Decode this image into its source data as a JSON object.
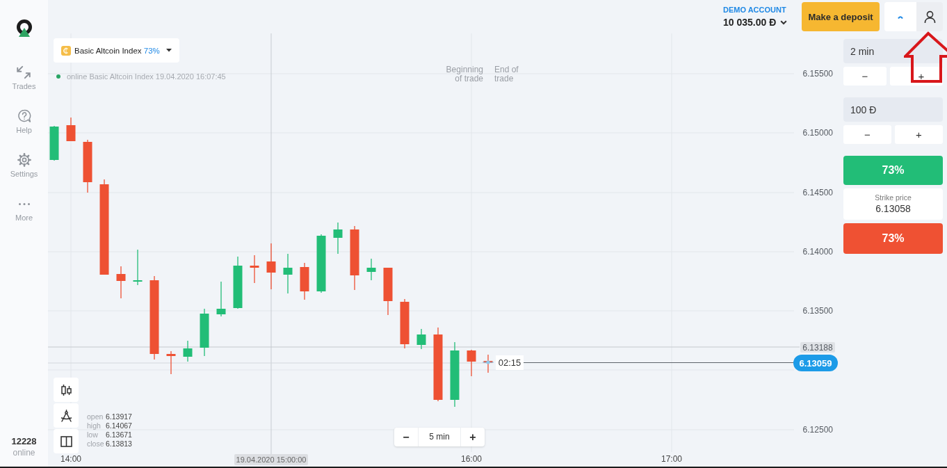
{
  "sidebar": {
    "items": [
      {
        "label": "Trades"
      },
      {
        "label": "Help"
      },
      {
        "label": "Settings"
      },
      {
        "label": "More"
      }
    ],
    "online_count": "12228",
    "online_label": "online"
  },
  "header": {
    "account_type": "DEMO ACCOUNT",
    "balance": "10 035.00 Đ",
    "deposit_button": "Make a deposit"
  },
  "chart": {
    "asset": "Basic Altcoin Index",
    "payout": "73%",
    "status": "online Basic Altcoin Index 19.04.2020 16:07:45",
    "trade_markers": [
      "Beginning of trade",
      "End of trade"
    ],
    "price_ticks": [
      "6.15500",
      "6.15000",
      "6.14500",
      "6.14000",
      "6.13500",
      "6.12500"
    ],
    "level_label": "6.13188",
    "current_price": "6.13059",
    "countdown": "02:15",
    "time_ticks": [
      "14:00",
      "16:00",
      "17:00"
    ],
    "crosshair_time": "19.04.2020 15:00:00",
    "ohlc": [
      {
        "label": "open",
        "value": "6.13917"
      },
      {
        "label": "high",
        "value": "6.14067"
      },
      {
        "label": "low",
        "value": "6.13671"
      },
      {
        "label": "close",
        "value": "6.13813"
      }
    ],
    "zoom": {
      "minus": "−",
      "interval": "5 min",
      "plus": "+"
    }
  },
  "trade_panel": {
    "duration": "2 min",
    "duration_stepper": [
      "−",
      "+"
    ],
    "amount": "100 Đ",
    "amount_stepper": [
      "−",
      "+"
    ],
    "rise_payout": "73%",
    "strike_label": "Strike price",
    "strike_price": "6.13058",
    "fall_payout": "73%"
  }
}
